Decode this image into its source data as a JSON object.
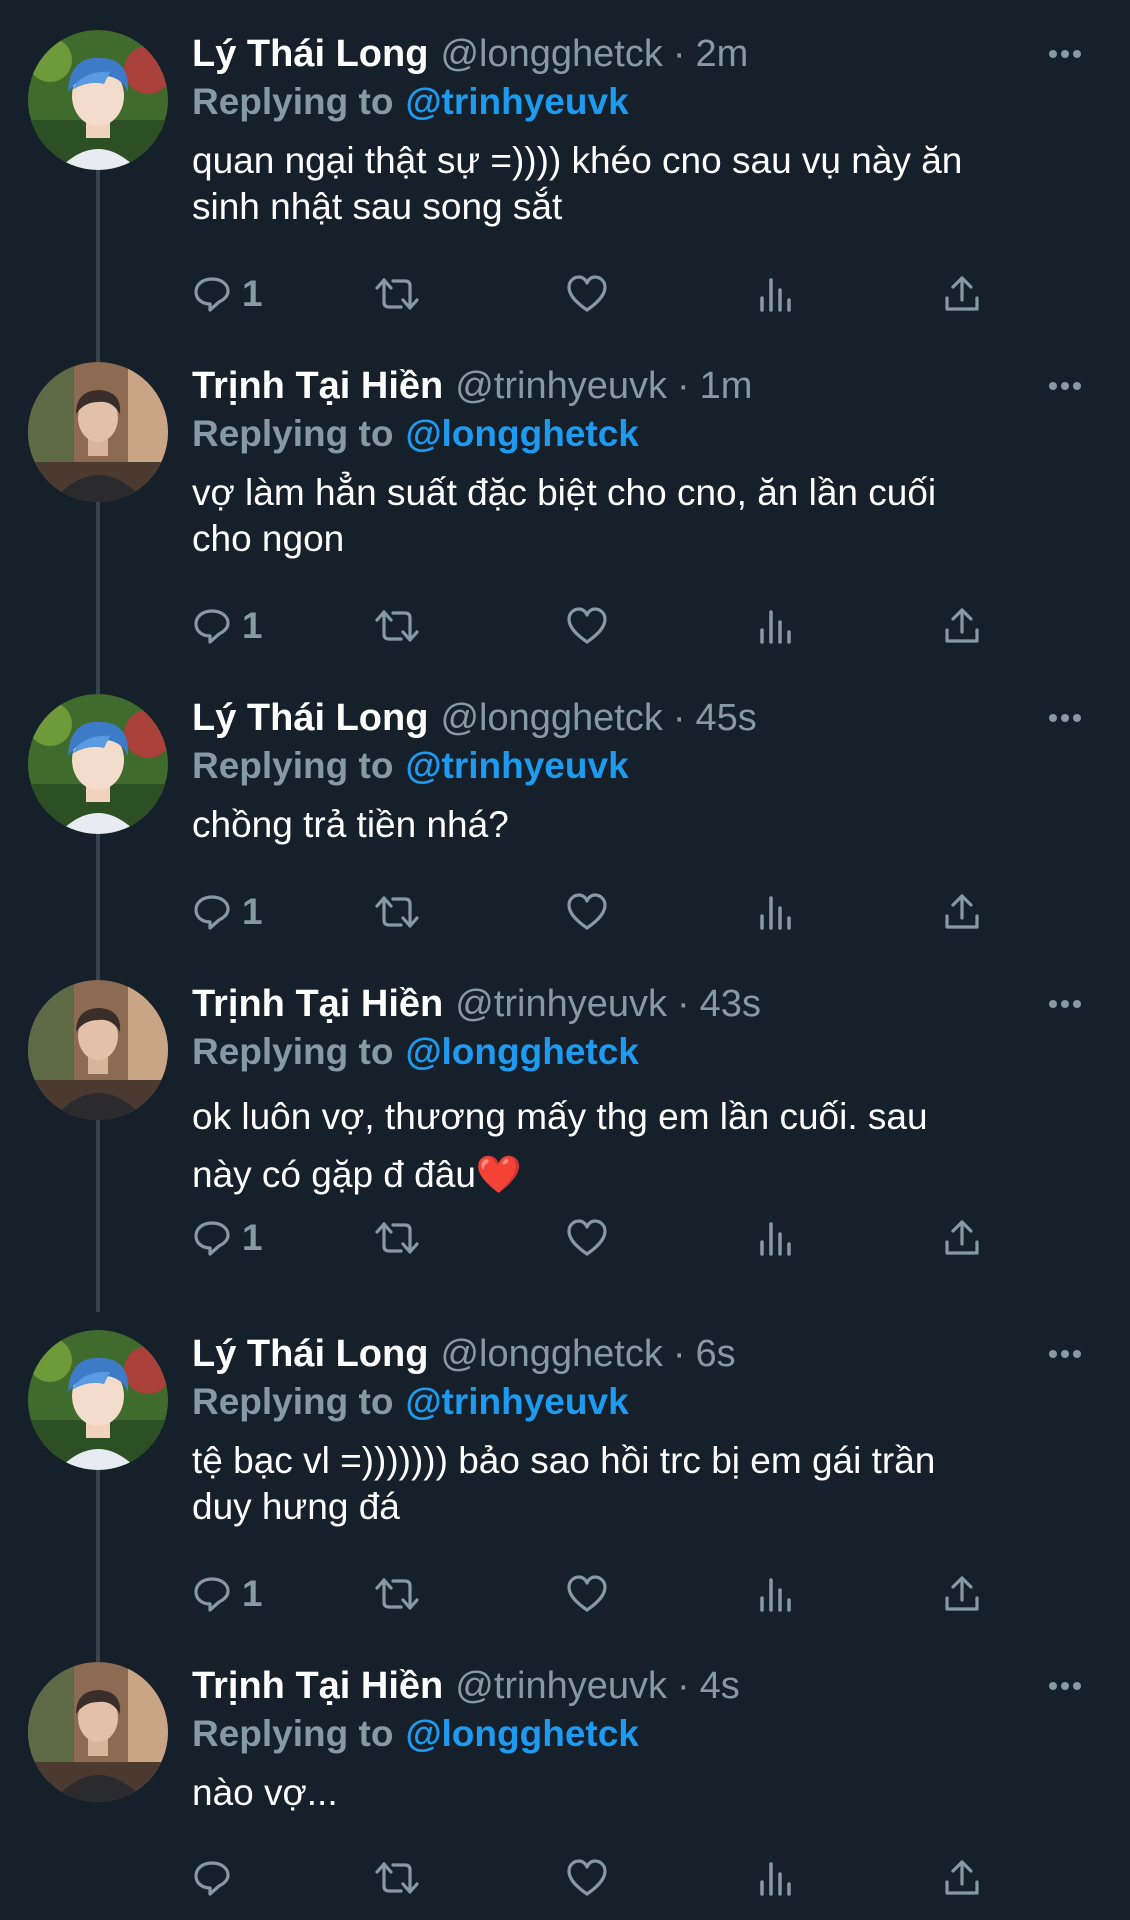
{
  "tweets": [
    {
      "display_name": "Lý Thái Long",
      "handle": "@longghetck",
      "separator": "·",
      "time": "2m",
      "replying_prefix": "Replying to",
      "replying_to": "@trinhyeuvk",
      "text": "quan ngại thật sự =)))) khéo cno sau vụ này ăn\nsinh nhật sau song sắt",
      "reply_count": "1",
      "avatar": "avatar-blue-hair"
    },
    {
      "display_name": "Trịnh Tại Hiền",
      "handle": "@trinhyeuvk",
      "separator": "·",
      "time": "1m",
      "replying_prefix": "Replying to",
      "replying_to": "@longghetck",
      "text": "vợ làm hẳn suất đặc biệt cho cno, ăn lần cuối\ncho ngon",
      "reply_count": "1",
      "avatar": "avatar-dark-jacket"
    },
    {
      "display_name": "Lý Thái Long",
      "handle": "@longghetck",
      "separator": "·",
      "time": "45s",
      "replying_prefix": "Replying to",
      "replying_to": "@trinhyeuvk",
      "text": "chồng trả tiền nhá?",
      "reply_count": "1",
      "avatar": "avatar-blue-hair"
    },
    {
      "display_name": "Trịnh Tại Hiền",
      "handle": "@trinhyeuvk",
      "separator": "·",
      "time": "43s",
      "replying_prefix": "Replying to",
      "replying_to": "@longghetck",
      "text": "ok luôn vợ, thương mấy thg em lần cuối. sau\nnày có gặp đ đâu❤️",
      "reply_count": "1",
      "avatar": "avatar-dark-jacket"
    },
    {
      "display_name": "Lý Thái Long",
      "handle": "@longghetck",
      "separator": "·",
      "time": "6s",
      "replying_prefix": "Replying to",
      "replying_to": "@trinhyeuvk",
      "text": "tệ bạc vl =))))))) bảo sao hồi trc bị em gái trần\nduy hưng đá",
      "reply_count": "1",
      "avatar": "avatar-blue-hair"
    },
    {
      "display_name": "Trịnh Tại Hiền",
      "handle": "@trinhyeuvk",
      "separator": "·",
      "time": "4s",
      "replying_prefix": "Replying to",
      "replying_to": "@longghetck",
      "text": "nào vợ...",
      "reply_count": "",
      "avatar": "avatar-dark-jacket"
    }
  ],
  "icons": {
    "reply": "reply-icon",
    "retweet": "retweet-icon",
    "like": "heart-icon",
    "views": "views-icon",
    "share": "share-icon",
    "more": "more-icon"
  },
  "colors": {
    "background": "#15202b",
    "text": "#ffffff",
    "secondary": "#8899a6",
    "accent": "#1d9bf0",
    "thread_line": "#38444d"
  }
}
